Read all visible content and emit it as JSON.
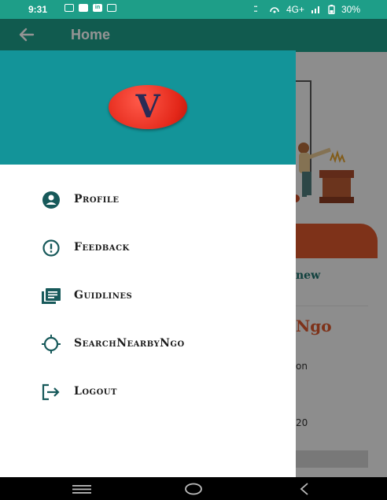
{
  "status_bar": {
    "time": "9:31",
    "network": "4G+",
    "battery": "30%",
    "icons": [
      "notification-icon",
      "mail-icon",
      "linkedin-icon",
      "notification-icon",
      "data-speed-icon",
      "hotspot-icon",
      "signal-icon",
      "battery-icon"
    ]
  },
  "app_bar": {
    "title": "Home",
    "back_icon": "arrow-left-icon"
  },
  "background_content": {
    "heading_fragment": "new",
    "title_fragment": "Ngo",
    "text_fragment_1": "on",
    "text_fragment_2": "20"
  },
  "drawer": {
    "logo_letter": "V",
    "header_color": "#139499",
    "items": [
      {
        "label": "Profile",
        "icon": "profile-icon"
      },
      {
        "label": "Feedback",
        "icon": "feedback-icon"
      },
      {
        "label": "Guidlines",
        "icon": "guidelines-icon"
      },
      {
        "label": "SearchNearbyNgo",
        "icon": "location-search-icon"
      },
      {
        "label": "Logout",
        "icon": "logout-icon"
      }
    ]
  },
  "colors": {
    "accent": "#1e9e88",
    "icon": "#17595a",
    "orange": "#d9572c"
  }
}
